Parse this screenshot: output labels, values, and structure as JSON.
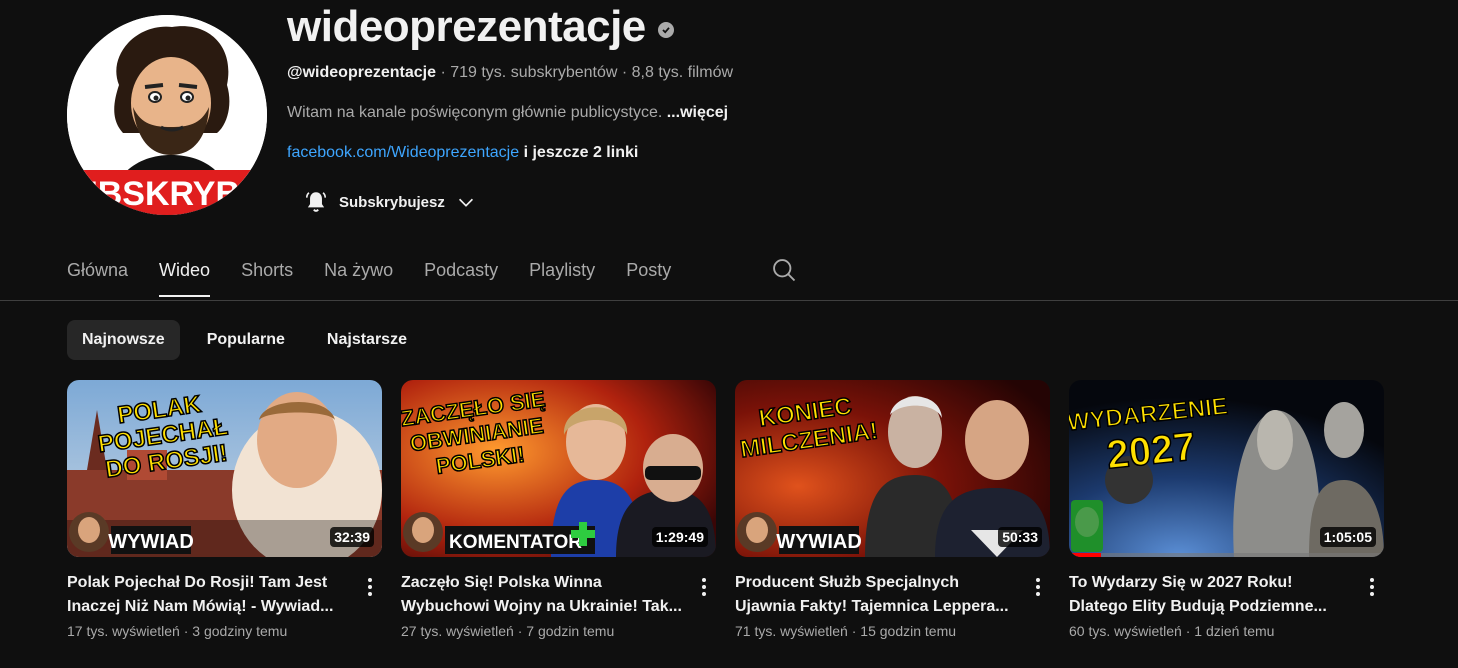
{
  "channel": {
    "name": "wideoprezentacje",
    "handle": "@wideoprezentacje",
    "subscribers": "719 tys. subskrybentów",
    "videos_count": "8,8 tys. filmów",
    "separator": "·",
    "description": "Witam na kanale poświęconym głównie publicystyce.",
    "more": "...więcej",
    "link": "facebook.com/Wideoprezentacje",
    "more_links": "i jeszcze 2 linki",
    "subscribe_label": "Subskrybujesz",
    "avatar_text": "SUBSKRYBUJ"
  },
  "tabs": [
    "Główna",
    "Wideo",
    "Shorts",
    "Na żywo",
    "Podcasty",
    "Playlisty",
    "Posty"
  ],
  "chips": [
    "Najnowsze",
    "Popularne",
    "Najstarsze"
  ],
  "videos": [
    {
      "title": "Polak Pojechał Do Rosji! Tam Jest Inaczej Niż Nam Mówią! - Wywiad...",
      "views": "17 tys. wyświetleń",
      "age": "3 godziny temu",
      "duration": "32:39",
      "overlay_lines": [
        "POLAK",
        "POJECHAŁ",
        "DO ROSJI!"
      ],
      "badge": "WYWIAD",
      "progress": 0
    },
    {
      "title": "Zaczęło Się! Polska Winna Wybuchowi Wojny na Ukrainie! Tak...",
      "views": "27 tys. wyświetleń",
      "age": "7 godzin temu",
      "duration": "1:29:49",
      "overlay_lines": [
        "ZACZĘŁO SIĘ",
        "OBWINIANIE",
        "POLSKI!"
      ],
      "badge": "KOMENTATOR",
      "progress": 0
    },
    {
      "title": "Producent Służb Specjalnych Ujawnia Fakty! Tajemnica Leppera...",
      "views": "71 tys. wyświetleń",
      "age": "15 godzin temu",
      "duration": "50:33",
      "overlay_lines": [
        "KONIEC",
        "MILCZENIA!"
      ],
      "badge": "WYWIAD",
      "progress": 0
    },
    {
      "title": "To Wydarzy Się w 2027 Roku! Dlatego Elity Budują Podziemne...",
      "views": "60 tys. wyświetleń",
      "age": "1 dzień temu",
      "duration": "1:05:05",
      "overlay_lines": [
        "WYDARZENIE",
        "2027"
      ],
      "badge": "",
      "progress": 0.1
    }
  ],
  "colors": {
    "background": "#0f0f0f",
    "text_primary": "#f1f1f1",
    "text_secondary": "#aaaaaa",
    "link": "#3ea6ff",
    "chip_active": "#272727",
    "progress": "#ff0000",
    "overlay_yellow": "#ffe000"
  }
}
